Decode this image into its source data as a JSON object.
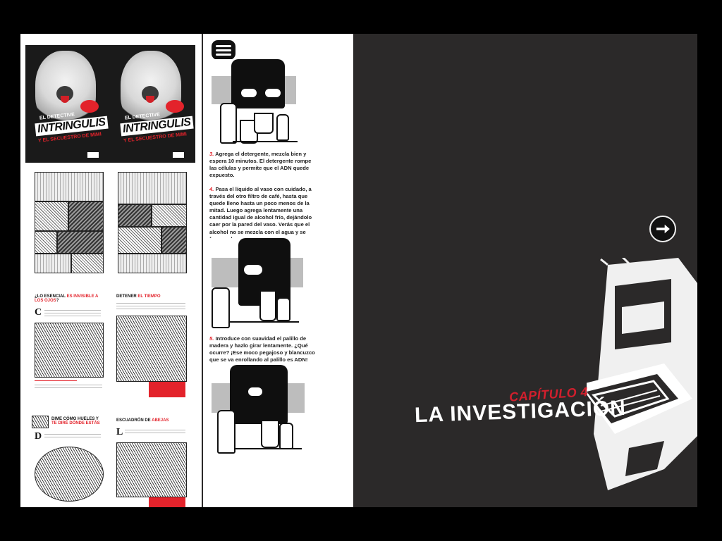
{
  "cover": {
    "kicker": "EL DETECTIVE",
    "title": "INTRINGULIS",
    "subtitle": "Y EL SECUESTRO DE MIMI"
  },
  "articles": {
    "left_1": {
      "head_a": "¿LO ESENCIAL ",
      "head_red": "ES INVISIBLE A LOS OJOS",
      "head_b": "?"
    },
    "right_1": {
      "head_a": "DETENER ",
      "head_red": "EL TIEMPO"
    },
    "left_2": {
      "head_a": "DIME CÓMO HUELES Y ",
      "head_red": "TE DIRÉ DÓNDE ESTÁS"
    },
    "right_2": {
      "head_a": "ESCUADRÓN DE ",
      "head_red": "ABEJAS"
    }
  },
  "steps": [
    {
      "num": "3.",
      "text": " Agrega el detergente, mezcla bien y espera 10 minutos. El detergente rompe las células y permite que el ADN quede expuesto."
    },
    {
      "num": "4.",
      "text": " Pasa el líquido al vaso con cuidado, a través del otro filtro de café, hasta que quede lleno hasta un poco menos de la mitad. Luego agrega lentamente una cantidad igual de alcohol frío, dejándolo caer por la pared del vaso. Verás que el alcohol no se mezcla con el agua y se forman dos capas."
    },
    {
      "num": "5.",
      "text": " Introduce con suavidad el palillo de madera y hazlo girar lentamente. ¿Qué ocurre? ¡Ese moco pegajoso y blancuzco que se va enrollando al palillo es ADN!"
    }
  ],
  "chapter": {
    "label": "CAPÍTULO 4",
    "title": "LA INVESTIGACIÓN"
  },
  "icons": {
    "menu": "hamburger-menu-icon",
    "next": "arrow-right-icon"
  },
  "colors": {
    "accent": "#e3232b",
    "page_dark": "#2b2929"
  }
}
